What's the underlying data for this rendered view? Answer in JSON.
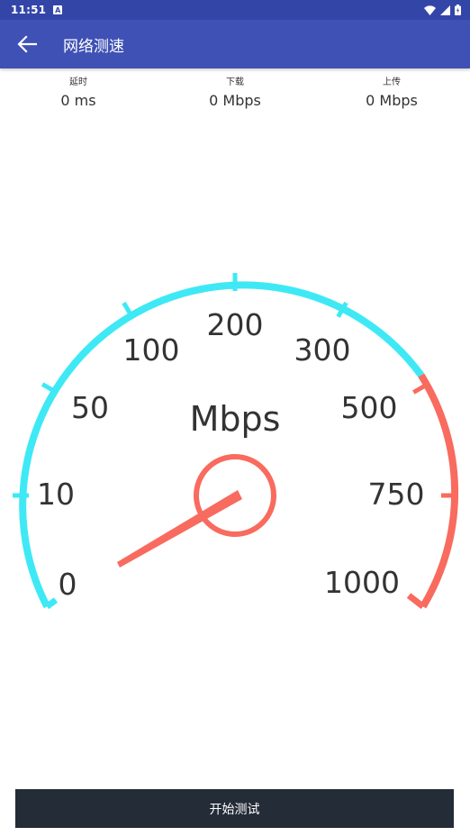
{
  "status_bar": {
    "time": "11:51",
    "notification_badge": "A",
    "icons": [
      "wifi-icon",
      "signal-icon",
      "battery-icon"
    ]
  },
  "app_bar": {
    "title": "网络测速",
    "back_icon": "arrow-back-icon"
  },
  "stats": [
    {
      "label": "延时",
      "value": "0 ms"
    },
    {
      "label": "下载",
      "value": "0 Mbps"
    },
    {
      "label": "上传",
      "value": "0 Mbps"
    }
  ],
  "gauge": {
    "unit": "Mbps",
    "scale_labels": [
      "0",
      "10",
      "50",
      "100",
      "200",
      "300",
      "500",
      "750",
      "1000"
    ],
    "current_value": 0,
    "colors": {
      "low": "#3ee9f5",
      "high": "#f86b5e"
    }
  },
  "start_button": {
    "label": "开始测试"
  }
}
